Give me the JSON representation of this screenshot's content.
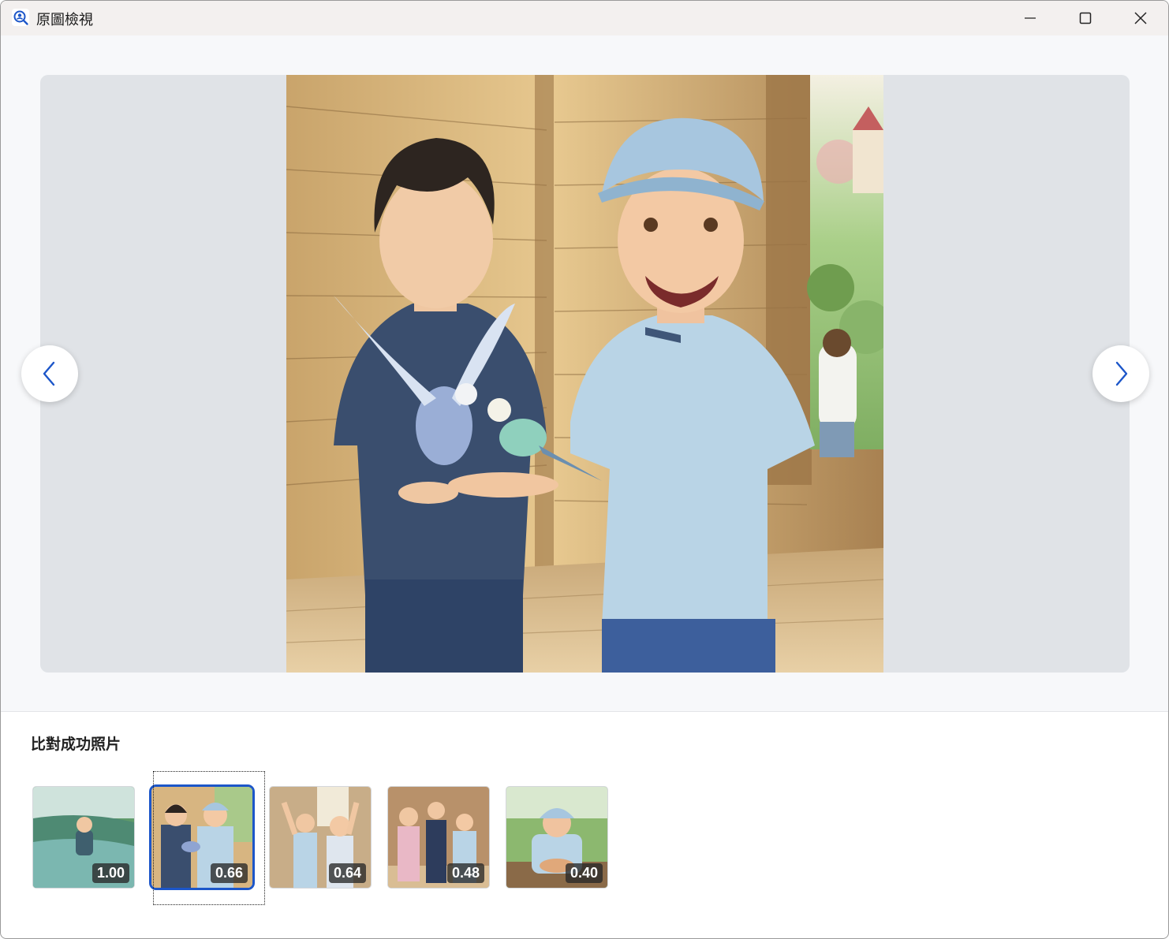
{
  "window": {
    "title": "原圖檢視",
    "icons": {
      "app": "user-search-icon",
      "minimize": "minimize-icon",
      "maximize": "maximize-icon",
      "close": "close-icon"
    }
  },
  "viewer": {
    "image_description": "illustration-two-boys-with-budgies",
    "prev_icon": "chevron-left-icon",
    "next_icon": "chevron-right-icon",
    "accent_color": "#1c56c9"
  },
  "matches": {
    "title": "比對成功照片",
    "items": [
      {
        "score": "1.00",
        "selected": false
      },
      {
        "score": "0.66",
        "selected": true
      },
      {
        "score": "0.64",
        "selected": false
      },
      {
        "score": "0.48",
        "selected": false
      },
      {
        "score": "0.40",
        "selected": false
      }
    ]
  }
}
